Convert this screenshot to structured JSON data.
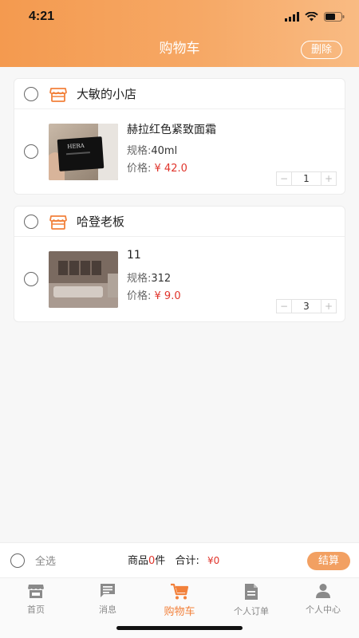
{
  "status_bar": {
    "time": "4:21"
  },
  "header": {
    "title": "购物车",
    "delete_label": "删除"
  },
  "shops": [
    {
      "name": "大敏的小店",
      "items": [
        {
          "name": "赫拉红色紧致面霜",
          "spec_label": "规格:",
          "spec_value": "40ml",
          "price_label": "价格:",
          "price_value": "¥ 42.0",
          "quantity": "1"
        }
      ]
    },
    {
      "name": "哈登老板",
      "items": [
        {
          "name": "11",
          "spec_label": "规格:",
          "spec_value": "312",
          "price_label": "价格:",
          "price_value": "¥ 9.0",
          "quantity": "3"
        }
      ]
    }
  ],
  "checkout": {
    "select_all_label": "全选",
    "goods_prefix": "商品",
    "goods_count": "0",
    "goods_suffix": "件",
    "total_label": "合计:",
    "total_value": "¥0",
    "pay_label": "结算"
  },
  "tabbar": {
    "items": [
      {
        "label": "首页",
        "icon": "store-icon"
      },
      {
        "label": "消息",
        "icon": "message-icon"
      },
      {
        "label": "购物车",
        "icon": "cart-icon"
      },
      {
        "label": "个人订单",
        "icon": "document-icon"
      },
      {
        "label": "个人中心",
        "icon": "person-icon"
      }
    ],
    "active_index": 2
  },
  "colors": {
    "accent": "#f2813b",
    "price": "#e0342b",
    "header_start": "#f49a4f",
    "header_end": "#f9bb83"
  }
}
